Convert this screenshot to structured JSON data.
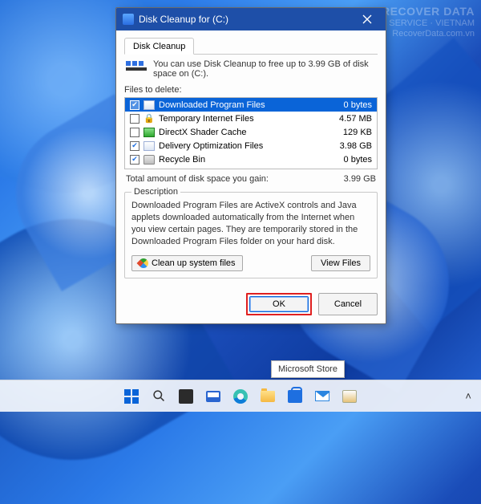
{
  "watermark": {
    "line1": "RECOVER",
    "line2": "DATA",
    "tag": "SERVICE · VIETNAM",
    "url": "RecoverData.com.vn"
  },
  "titlebar": {
    "title": "Disk Cleanup for  (C:)"
  },
  "tab": {
    "label": "Disk Cleanup"
  },
  "intro": "You can use Disk Cleanup to free up to 3.99 GB of disk space on  (C:).",
  "filesLabel": "Files to delete:",
  "files": [
    {
      "checked": true,
      "icon": "file",
      "name": "Downloaded Program Files",
      "size": "0 bytes",
      "selected": true
    },
    {
      "checked": false,
      "icon": "lock",
      "name": "Temporary Internet Files",
      "size": "4.57 MB",
      "selected": false
    },
    {
      "checked": false,
      "icon": "dx",
      "name": "DirectX Shader Cache",
      "size": "129 KB",
      "selected": false
    },
    {
      "checked": true,
      "icon": "file",
      "name": "Delivery Optimization Files",
      "size": "3.98 GB",
      "selected": false
    },
    {
      "checked": true,
      "icon": "bin",
      "name": "Recycle Bin",
      "size": "0 bytes",
      "selected": false
    }
  ],
  "total": {
    "label": "Total amount of disk space you gain:",
    "value": "3.99 GB"
  },
  "description": {
    "legend": "Description",
    "text": "Downloaded Program Files are ActiveX controls and Java applets downloaded automatically from the Internet when you view certain pages. They are temporarily stored in the Downloaded Program Files folder on your hard disk."
  },
  "buttons": {
    "cleanSystem": "Clean up system files",
    "viewFiles": "View Files",
    "ok": "OK",
    "cancel": "Cancel"
  },
  "tooltip": "Microsoft Store"
}
